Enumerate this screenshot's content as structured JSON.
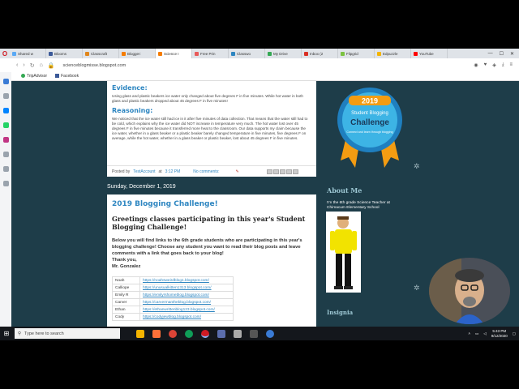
{
  "browser": {
    "tabs": [
      {
        "label": "Shared w",
        "color": "#5aa9f5"
      },
      {
        "label": "Blooms",
        "color": "#3c5a99"
      },
      {
        "label": "Classcraft",
        "color": "#e0861c"
      },
      {
        "label": "Blogger:",
        "color": "#f57c00"
      },
      {
        "label": "Science I",
        "color": "#f57c00"
      },
      {
        "label": "Free Prin",
        "color": "#e85a5a"
      },
      {
        "label": "Classwo",
        "color": "#2e86c1"
      },
      {
        "label": "My Drive",
        "color": "#34a853"
      },
      {
        "label": "Inbox (2",
        "color": "#d93025"
      },
      {
        "label": "Flipgrid",
        "color": "#7cc242"
      },
      {
        "label": "Edpuzzle",
        "color": "#f4b400"
      },
      {
        "label": "YouTube",
        "color": "#ff0000"
      }
    ],
    "url": "scienceblogmisse.blogspot.com",
    "bookmarks": [
      {
        "label": "TripAdvisor",
        "color": "#34a853"
      },
      {
        "label": "Facebook",
        "color": "#3b5998"
      }
    ]
  },
  "post1": {
    "evidence_heading": "Evidence:",
    "evidence_text": "Using glass and plastic beakers ice water only changed about five degrees F in five minutes. While hot water in both glass and plastic beakers dropped about 45 degrees F in five minutes!",
    "reasoning_heading": "Reasoning:",
    "reasoning_text": "We noticed that the ice water still had ice in it after five minutes of data collection. That means that the water still had to be cold, which explains why the ice water did NOT increase in temperature very much. The hot water lost over 45 degrees F in five minutes because it transferred more heat to the classroom. Our data supports my claim because the ice water, whether in a glass beaker or a plastic beaker barely changed temperature in five minutes, five degrees F on average, while the hot water, whether in a glass beaker or plastic beaker, lost about 45 degrees F in five minutes.",
    "posted_by": "Posted by",
    "author": "TestAccount",
    "at": "at",
    "time": "3:12 PM",
    "comments": "No comments:"
  },
  "date_header": "Sunday, December 1, 2019",
  "post2": {
    "title": "2019 Blogging Challenge!",
    "subtitle": "Greetings classes participating in this year's Student Blogging Challenge!",
    "body": "Below you will find links to the 6th grade students who are participating in this year's blogging challenge! Choose any student you want to read their blog posts and leave comments with a link that goes back to your blog!",
    "thanks": "Thank you,",
    "signature": "Mr. Gonzalez",
    "students": [
      {
        "name": "Noah",
        "url": "https://noahsweirdblog1.blogspot.com/"
      },
      {
        "name": "Calliope",
        "url": "https://unusualkitten1313.blogspot.com/"
      },
      {
        "name": "Emily R",
        "url": "https://emilyrshomeblog.blogspot.com/"
      },
      {
        "name": "Carver",
        "url": "https://carvermantheblog.blogspot.com/"
      },
      {
        "name": "Ethan",
        "url": "https://ethanwrittenblog123.blogspot.com/"
      },
      {
        "name": "Cody",
        "url": "https://codyjewblog.blogspot.com/"
      }
    ]
  },
  "sidebar": {
    "badge_year": "2019",
    "badge_line1": "Student Blogging",
    "badge_line2": "Challenge",
    "badge_tagline": "Connect and learn through blogging",
    "about_heading": "About Me",
    "about_text": "I'm the 6th grade Science Teacher at Chimacum Elementary School",
    "insignia_heading": "Insignia"
  },
  "taskbar": {
    "search_placeholder": "Type here to search",
    "time": "5:43 PM",
    "date": "9/12/2020"
  }
}
